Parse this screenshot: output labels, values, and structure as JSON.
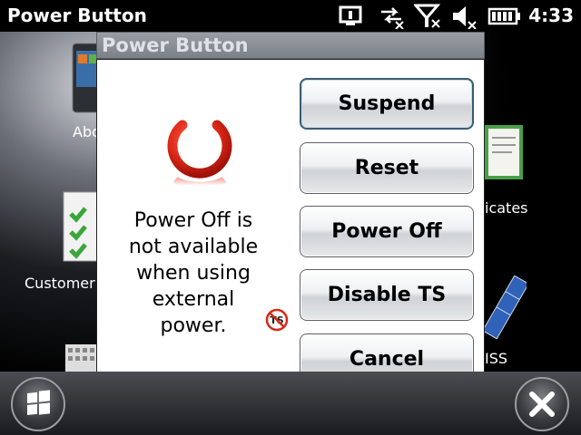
{
  "status_bar": {
    "app_title": "Power Button",
    "clock": "4:33",
    "icons": [
      "sync-icon",
      "connectivity-icon",
      "signal-off-icon",
      "volume-off-icon",
      "battery-icon"
    ]
  },
  "desktop": {
    "labels": {
      "about_partial": "Abo",
      "customer_partial": "Customer",
      "certificates_partial": "icates",
      "iss_partial": "ISS"
    }
  },
  "dialog": {
    "title": "Power Button",
    "message_lines": [
      "Power Off is",
      "not available",
      "when using",
      "external",
      "power."
    ],
    "buttons": {
      "suspend": "Suspend",
      "reset": "Reset",
      "power_off": "Power Off",
      "disable_ts": "Disable TS",
      "cancel": "Cancel"
    }
  },
  "colors": {
    "power_icon_red": "#e02a1a",
    "button_focus_border": "#3a5d74"
  }
}
